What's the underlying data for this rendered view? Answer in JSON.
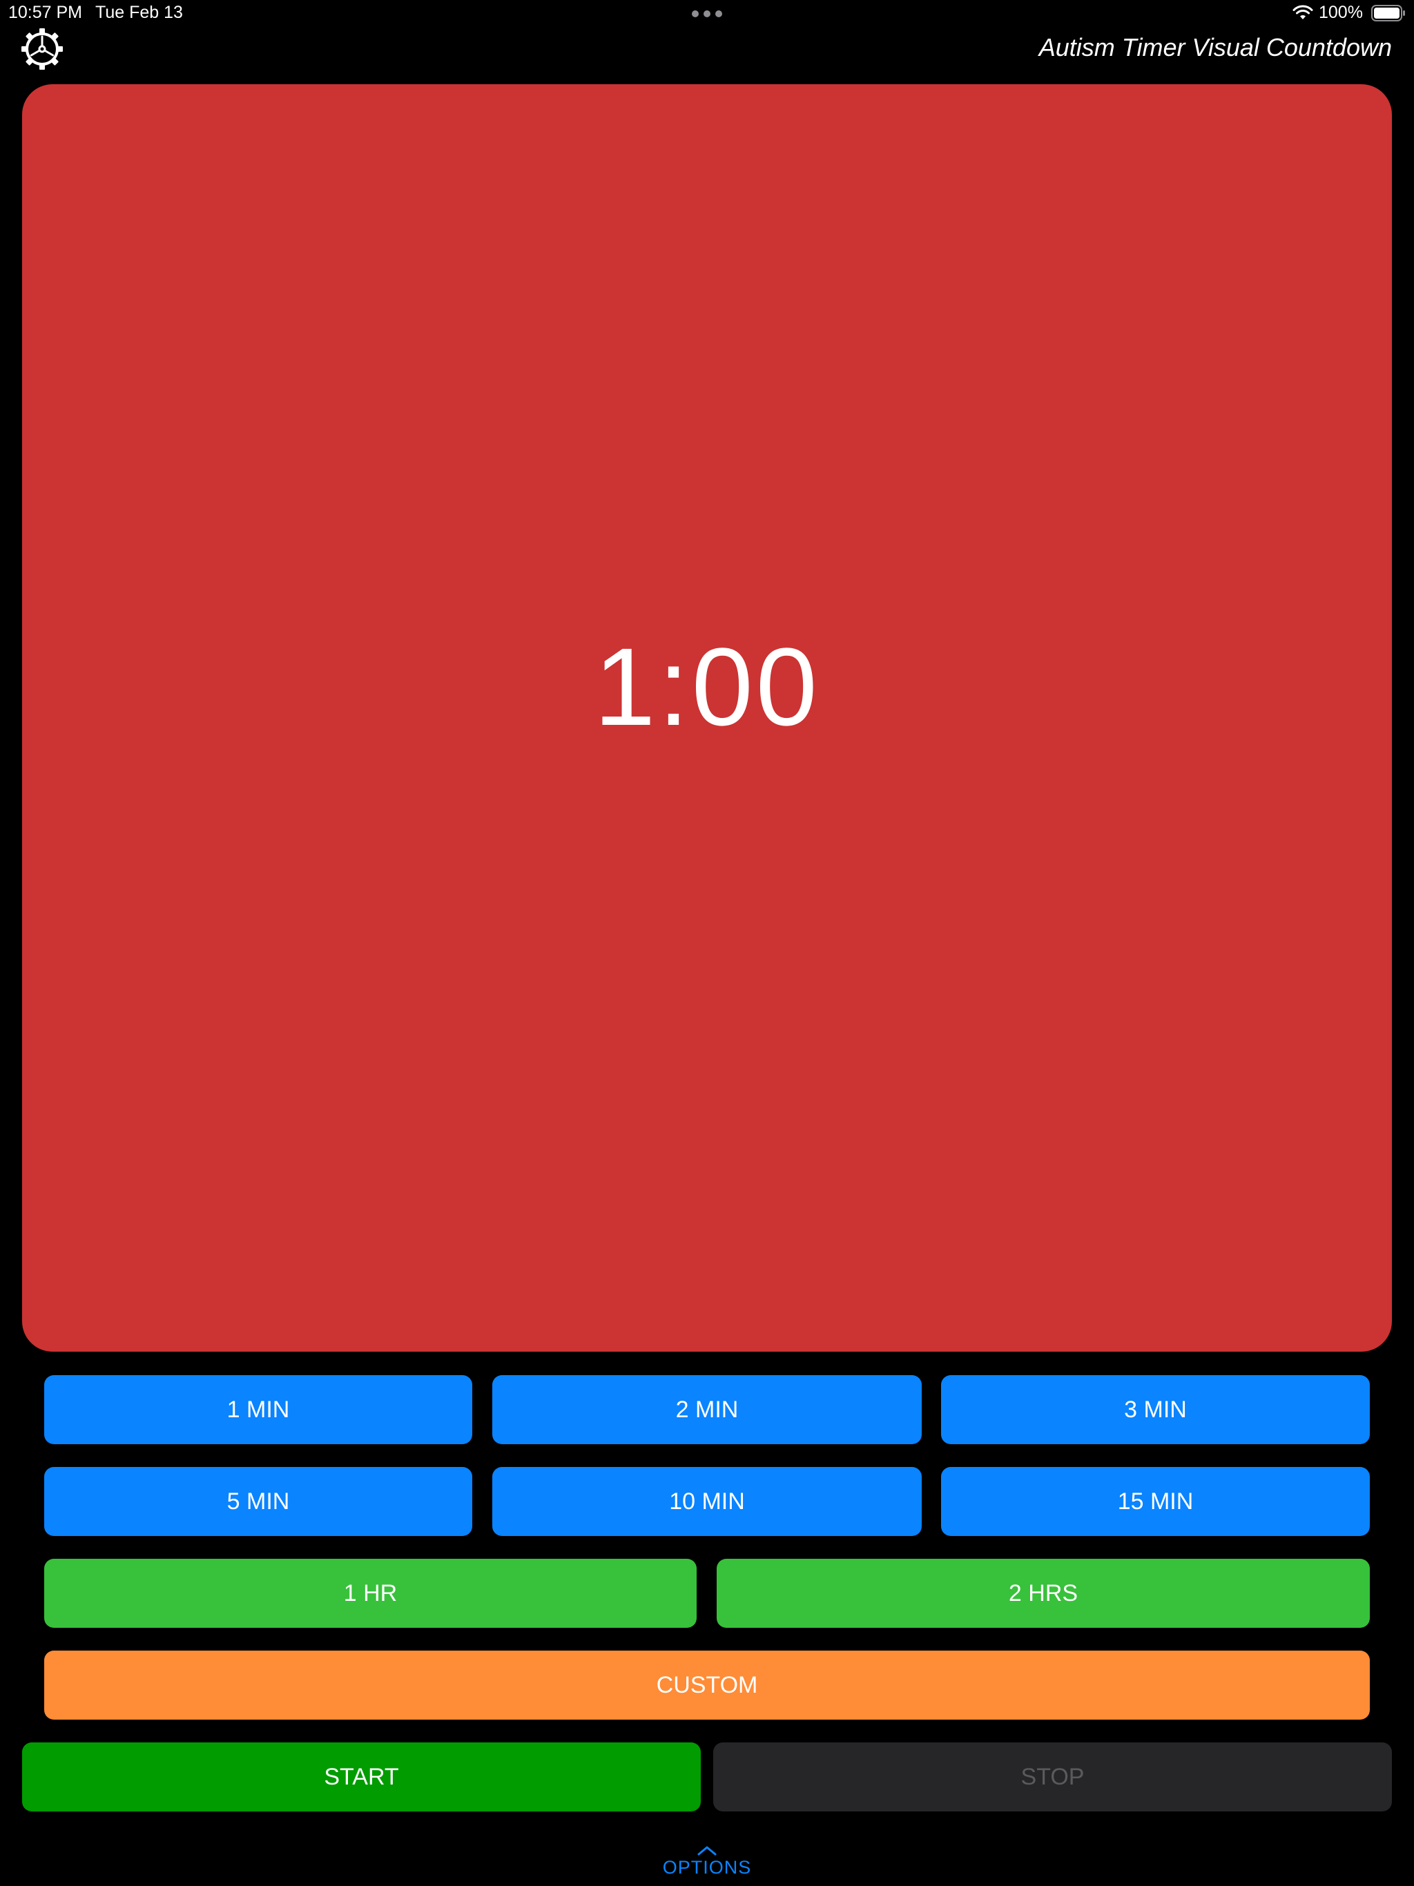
{
  "status_bar": {
    "time": "10:57 PM",
    "date": "Tue Feb 13",
    "battery": "100%"
  },
  "header": {
    "settings_icon": "gear-play-icon",
    "title": "Autism Timer Visual Countdown"
  },
  "timer": {
    "value": "1:00",
    "color": "#cc3333"
  },
  "presets": {
    "row1": [
      "1 MIN",
      "2 MIN",
      "3 MIN"
    ],
    "row2": [
      "5 MIN",
      "10 MIN",
      "15 MIN"
    ],
    "row3": [
      "1 HR",
      "2 HRS"
    ],
    "custom": "CUSTOM"
  },
  "controls": {
    "start": "START",
    "stop": "STOP",
    "stop_enabled": false
  },
  "options": {
    "label": "OPTIONS"
  },
  "colors": {
    "preset_blue": "#0a84ff",
    "preset_green": "#38c13b",
    "custom_orange": "#ff8c37",
    "start_green": "#009c00",
    "stop_disabled_bg": "#262628",
    "stop_disabled_text": "#5a5a5e",
    "options_blue": "#0a84ff"
  }
}
